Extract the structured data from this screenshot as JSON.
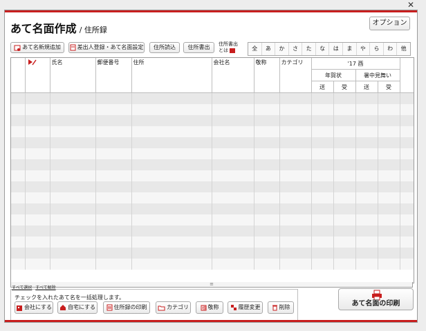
{
  "window": {
    "close_glyph": "✕"
  },
  "header": {
    "title": "あて名面作成",
    "subtitle": "/ 住所録",
    "option_label": "オプション"
  },
  "toolbar": {
    "add_new_label": "あて名新規追加",
    "sender_setup_label": "差出人登録・あて名面設定",
    "import_label": "住所読込",
    "export_label": "住所書出",
    "export_about_label": "住所書出とは"
  },
  "kana_tabs": [
    "全",
    "あ",
    "か",
    "さ",
    "た",
    "な",
    "は",
    "ま",
    "や",
    "ら",
    "わ",
    "他"
  ],
  "grid": {
    "columns": {
      "name": "氏名",
      "postal": "郵便番号",
      "address": "住所",
      "company": "会社名",
      "honorific": "敬称",
      "category": "カテゴリ"
    },
    "year_group": "'17 酉",
    "nengajo": "年賀状",
    "shochu": "暑中見舞い",
    "sent": "送",
    "received": "受",
    "row_count": 16
  },
  "selection_links": {
    "select_all": "すべて選択",
    "deselect_all": "すべて解除"
  },
  "bulk_note": "チェックを入れたあて名を一括処理します。",
  "bulk_buttons": {
    "to_company": "会社にする",
    "to_home": "自宅にする",
    "print_list": "住所録の印刷",
    "category": "カテゴリ",
    "honorific": "敬称",
    "history": "履歴変更",
    "delete": "削除"
  },
  "print_button": "あて名面の印刷",
  "colors": {
    "accent": "#c81e1e"
  }
}
